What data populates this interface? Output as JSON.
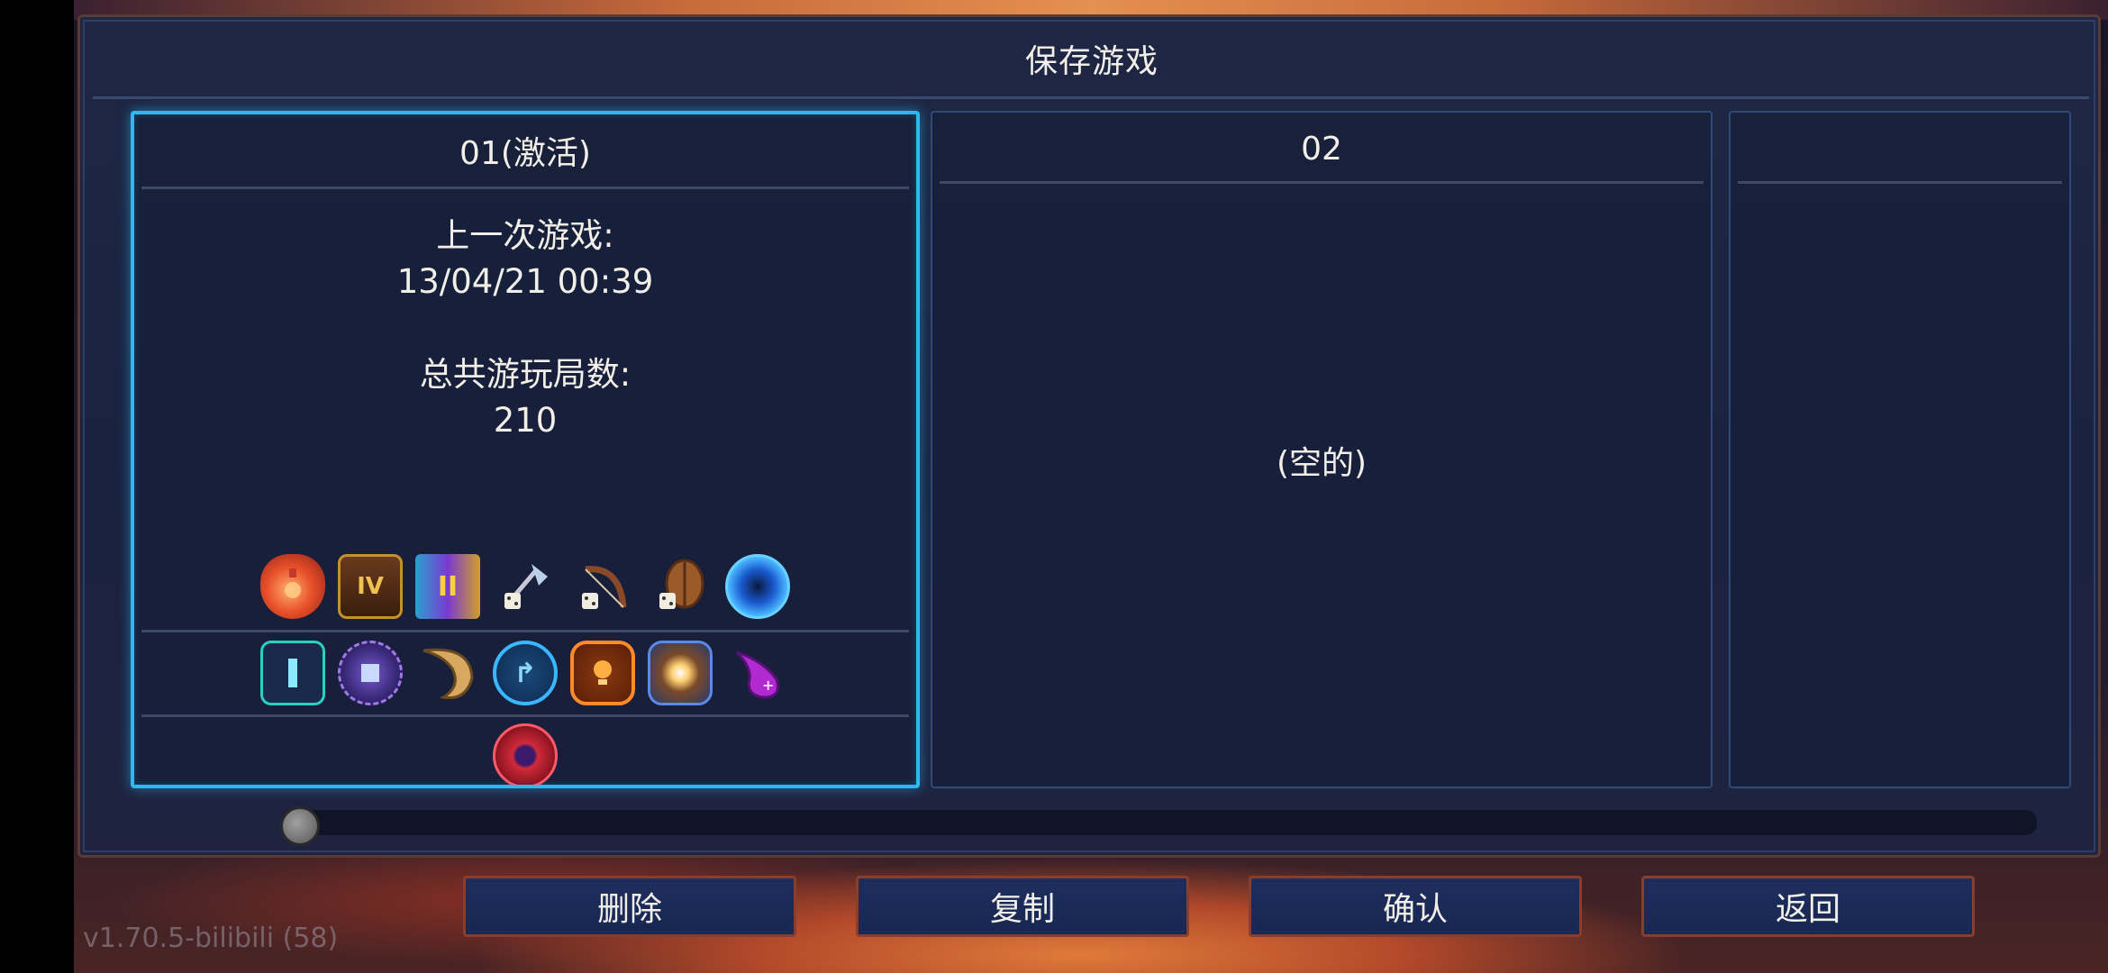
{
  "title": "保存游戏",
  "slots": [
    {
      "header": "01(激活)",
      "last_played_label": "上一次游戏:",
      "last_played_value": "13/04/21 00:39",
      "total_runs_label": "总共游玩局数:",
      "total_runs_value": "210"
    },
    {
      "header": "02",
      "empty_label": "(空的)"
    },
    {
      "header": ""
    }
  ],
  "item_rows": [
    [
      "red-potion-flask-icon",
      "tier-iv-chest-icon",
      "tier-ii-scroll-icon",
      "axe-blueprint-icon",
      "bow-blueprint-icon",
      "wooden-shield-blueprint-icon",
      "blue-vortex-orb-icon"
    ],
    [
      "cyan-rune-glyph-icon",
      "purple-cube-rune-icon",
      "horn-icon",
      "blue-arrow-rune-icon",
      "orange-bulb-rune-icon",
      "spark-rune-icon",
      "purple-flame-icon"
    ],
    [
      "red-eye-orb-icon"
    ]
  ],
  "buttons": {
    "delete": "删除",
    "copy": "复制",
    "confirm": "确认",
    "back": "返回"
  },
  "version": "v1.70.5-bilibili (58)",
  "colors": {
    "active_border": "#2fb8ee",
    "panel_bg": "#1e2744",
    "button_border": "#8a3e2a"
  }
}
